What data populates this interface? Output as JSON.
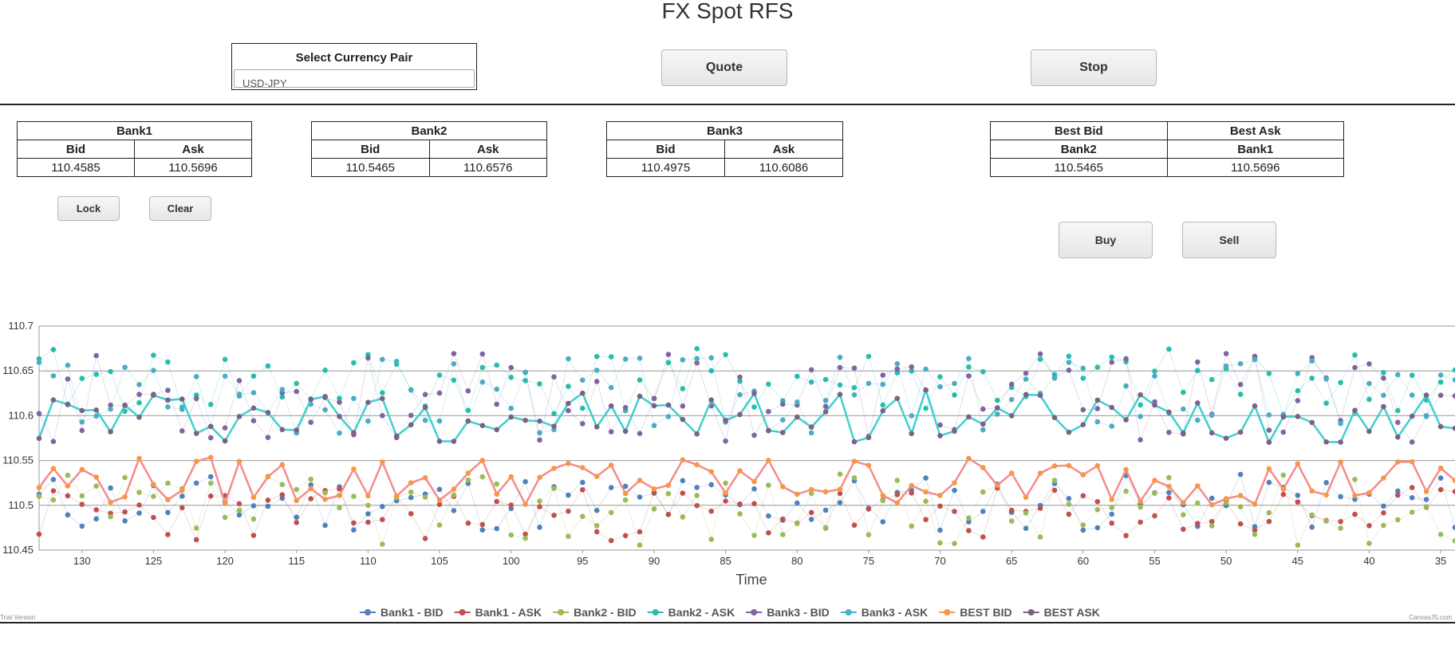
{
  "title": "FX Spot RFS",
  "currency_pair": {
    "label": "Select Currency Pair",
    "value": "USD-JPY"
  },
  "buttons": {
    "quote": "Quote",
    "stop": "Stop",
    "lock": "Lock",
    "clear": "Clear",
    "buy": "Buy",
    "sell": "Sell"
  },
  "banks": [
    {
      "name": "Bank1",
      "bid_label": "Bid",
      "ask_label": "Ask",
      "bid": "110.4585",
      "ask": "110.5696"
    },
    {
      "name": "Bank2",
      "bid_label": "Bid",
      "ask_label": "Ask",
      "bid": "110.5465",
      "ask": "110.6576"
    },
    {
      "name": "Bank3",
      "bid_label": "Bid",
      "ask_label": "Ask",
      "bid": "110.4975",
      "ask": "110.6086"
    }
  ],
  "best": {
    "bid_label": "Best Bid",
    "ask_label": "Best Ask",
    "bid_bank": "Bank2",
    "ask_bank": "Bank1",
    "bid": "110.5465",
    "ask": "110.5696"
  },
  "watermark_left": "Trial Version",
  "watermark_right": "CanvasJS.com",
  "chart_data": {
    "type": "line",
    "xlabel": "Time",
    "ylabel": "",
    "xlim": [
      133,
      34
    ],
    "ylim": [
      110.45,
      110.7
    ],
    "x_ticks": [
      130,
      125,
      120,
      115,
      110,
      105,
      100,
      95,
      90,
      85,
      80,
      75,
      70,
      65,
      60,
      55,
      50,
      45,
      40,
      35
    ],
    "y_ticks": [
      "110.45",
      "110.5",
      "110.55",
      "110.6",
      "110.65",
      "110.7"
    ],
    "grid": true,
    "legend_position": "bottom",
    "series": [
      {
        "name": "Bank1 - BID",
        "color": "#4f81bc",
        "seed": 11,
        "base": 110.47,
        "spread": 0.065,
        "faint": true
      },
      {
        "name": "Bank1 - ASK",
        "color": "#c0504e",
        "seed": 23,
        "base": 110.46,
        "spread": 0.06,
        "faint": true
      },
      {
        "name": "Bank2 - BID",
        "color": "#9bbb58",
        "seed": 37,
        "base": 110.455,
        "spread": 0.08,
        "faint": true
      },
      {
        "name": "Bank2 - ASK",
        "color": "#23bfaa",
        "seed": 41,
        "base": 110.6,
        "spread": 0.075,
        "faint": true
      },
      {
        "name": "Bank3 - BID",
        "color": "#8064a1",
        "seed": 53,
        "base": 110.57,
        "spread": 0.1,
        "faint": true
      },
      {
        "name": "Bank3 - ASK",
        "color": "#4aacc5",
        "seed": 67,
        "base": 110.58,
        "spread": 0.09,
        "faint": true
      },
      {
        "name": "BEST BID",
        "color": "#f79647",
        "seed": 79,
        "base": 110.5,
        "spread": 0.055,
        "faint": false,
        "line_color": "#f58b8b"
      },
      {
        "name": "BEST ASK",
        "color": "#7f6084",
        "seed": 97,
        "base": 110.57,
        "spread": 0.06,
        "faint": false,
        "line_color": "#3fcfd0"
      }
    ]
  }
}
